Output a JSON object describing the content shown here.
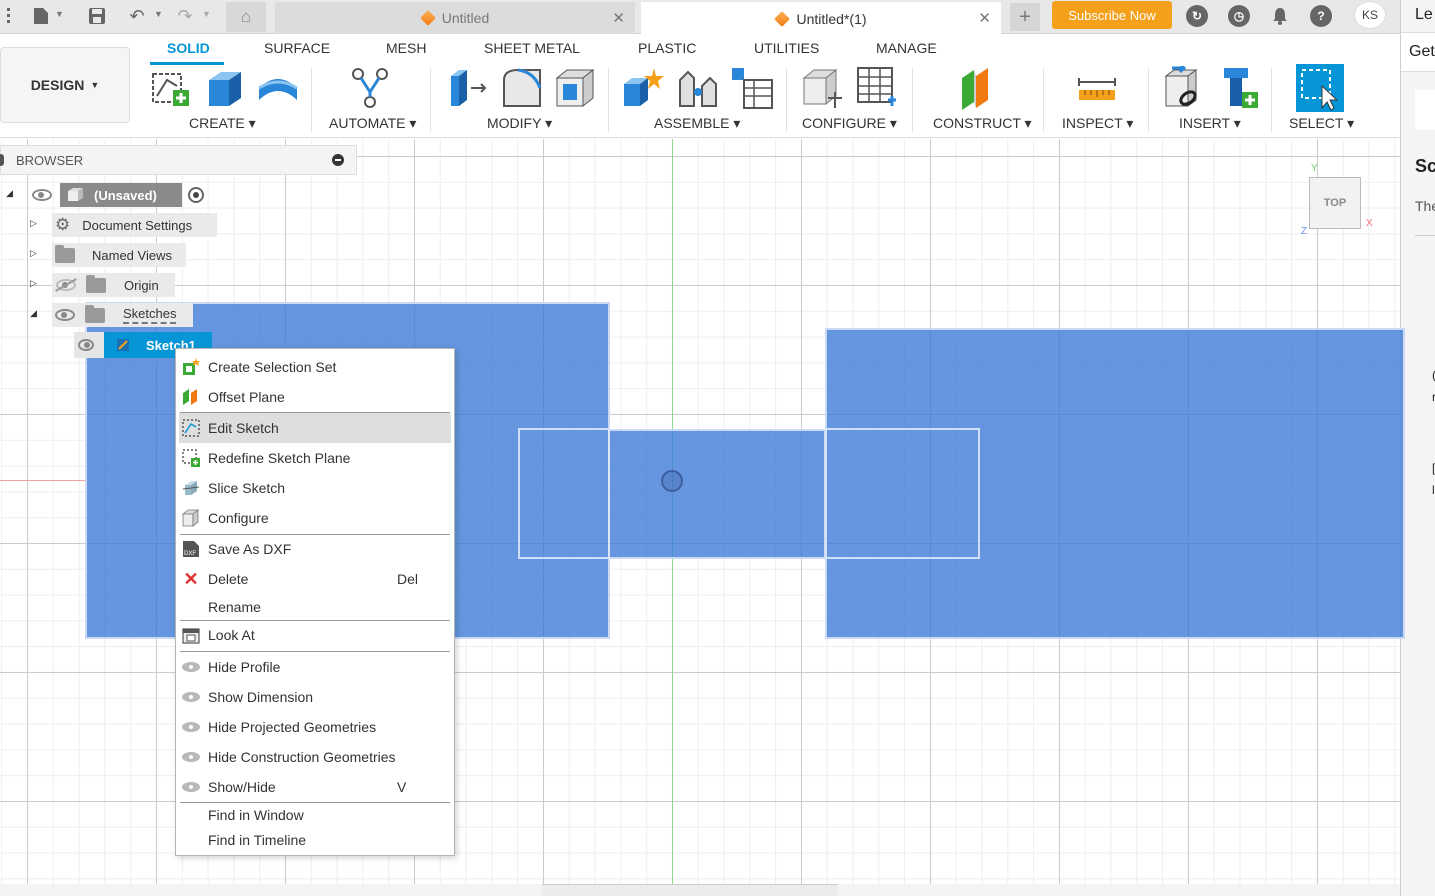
{
  "window": {
    "tabs": [
      {
        "label": "Untitled",
        "active": false
      },
      {
        "label": "Untitled*(1)",
        "active": true
      }
    ],
    "subscribe_label": "Subscribe Now",
    "user_initials": "KS",
    "icons": [
      "file-icon",
      "save-icon",
      "undo-icon",
      "redo-icon",
      "home-icon",
      "new-tab-icon",
      "extensions-icon",
      "job-status-icon",
      "notifications-icon",
      "help-icon"
    ]
  },
  "right_panel": {
    "title": "Le",
    "button": "Get",
    "heading": "Sc",
    "text": "The",
    "frag1": "(",
    "frag2": "r",
    "frag3": "[",
    "frag4": "l"
  },
  "ribbon": {
    "workspace": "DESIGN",
    "tabs": [
      "SOLID",
      "SURFACE",
      "MESH",
      "SHEET METAL",
      "PLASTIC",
      "UTILITIES",
      "MANAGE"
    ],
    "active_tab": "SOLID",
    "groups": [
      "CREATE",
      "AUTOMATE",
      "MODIFY",
      "ASSEMBLE",
      "CONFIGURE",
      "CONSTRUCT",
      "INSPECT",
      "INSERT",
      "SELECT"
    ],
    "accent": "#0696d7"
  },
  "browser": {
    "title": "BROWSER",
    "nodes": {
      "root": "(Unsaved)",
      "doc_settings": "Document Settings",
      "named_views": "Named Views",
      "origin": "Origin",
      "sketches": "Sketches",
      "sketch1": "Sketch1"
    }
  },
  "viewcube": {
    "face": "TOP",
    "x": "X",
    "y": "Y",
    "z": "Z"
  },
  "context_menu": {
    "items": {
      "create_selection_set": "Create Selection Set",
      "offset_plane": "Offset Plane",
      "edit_sketch": "Edit Sketch",
      "redefine_sketch_plane": "Redefine Sketch Plane",
      "slice_sketch": "Slice Sketch",
      "configure": "Configure",
      "save_as_dxf": "Save As DXF",
      "delete": "Delete",
      "delete_shortcut": "Del",
      "rename": "Rename",
      "look_at": "Look At",
      "hide_profile": "Hide Profile",
      "show_dimension": "Show Dimension",
      "hide_projected": "Hide Projected Geometries",
      "hide_construction": "Hide Construction Geometries",
      "show_hide": "Show/Hide",
      "show_hide_shortcut": "V",
      "find_in_window": "Find in Window",
      "find_in_timeline": "Find in Timeline"
    },
    "highlighted": "Edit Sketch"
  },
  "colors": {
    "sketch_profile": "#3a78d6",
    "subscribe": "#f5a01a",
    "selection": "#0696d7"
  }
}
